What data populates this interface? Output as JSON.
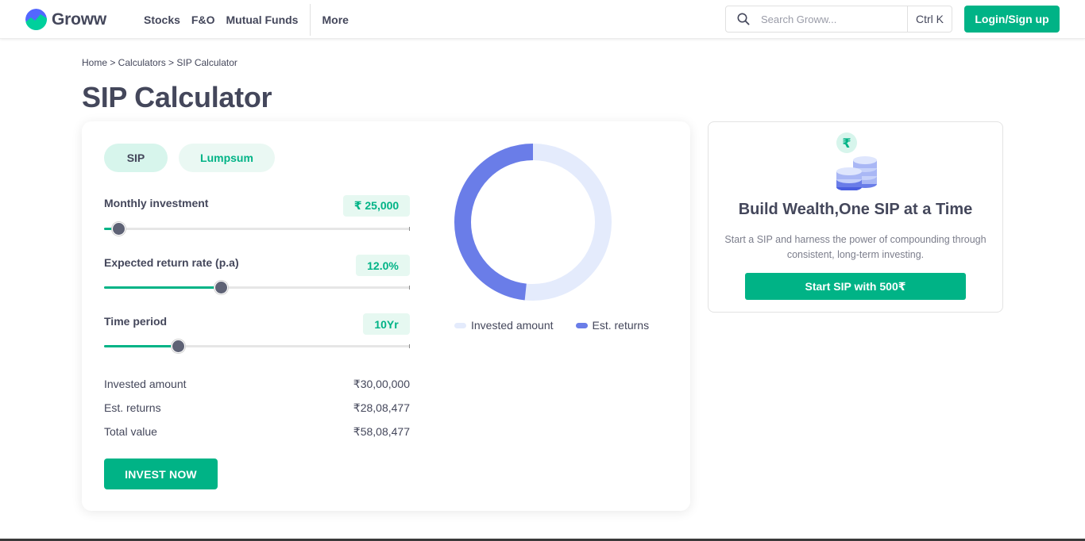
{
  "brand": {
    "name": "Groww"
  },
  "nav": {
    "items": [
      {
        "label": "Stocks"
      },
      {
        "label": "F&O"
      },
      {
        "label": "Mutual Funds"
      }
    ],
    "more_label": "More"
  },
  "search": {
    "placeholder": "Search Groww...",
    "shortcut": "Ctrl K",
    "icon": "search-icon"
  },
  "login_label": "Login/Sign up",
  "breadcrumb": "Home > Calculators > SIP Calculator",
  "page_title": "SIP Calculator",
  "tabs": {
    "sip": "SIP",
    "lumpsum": "Lumpsum",
    "active": "SIP"
  },
  "inputs": {
    "monthly_investment": {
      "label": "Monthly investment",
      "value": "₹ 25,000",
      "fill": 0.05
    },
    "return_rate": {
      "label": "Expected return rate (p.a)",
      "value": "12.0%",
      "fill": 0.385
    },
    "time_period": {
      "label": "Time period",
      "value": "10Yr",
      "fill": 0.245
    }
  },
  "summary": {
    "invested": {
      "label": "Invested amount",
      "value": "₹30,00,000"
    },
    "returns": {
      "label": "Est. returns",
      "value": "₹28,08,477"
    },
    "total": {
      "label": "Total value",
      "value": "₹58,08,477"
    }
  },
  "invest_button": "INVEST NOW",
  "chart_data": {
    "type": "pie",
    "style": "donut",
    "categories": [
      "Invested amount",
      "Est. returns"
    ],
    "values": [
      3000000,
      2808477
    ],
    "colors": [
      "#e4ebfc",
      "#6a7de8"
    ],
    "legend_position": "bottom"
  },
  "promo": {
    "title": "Build Wealth,One SIP at a Time",
    "description": "Start a SIP and harness the power of compounding through consistent, long-term investing.",
    "button": "Start SIP with 500₹",
    "icon": "rupee-coins-icon",
    "rupee_symbol": "₹"
  },
  "colors": {
    "accent": "#00b386",
    "text": "#44475b",
    "returns": "#6a7de8",
    "invested": "#e4ebfc"
  }
}
